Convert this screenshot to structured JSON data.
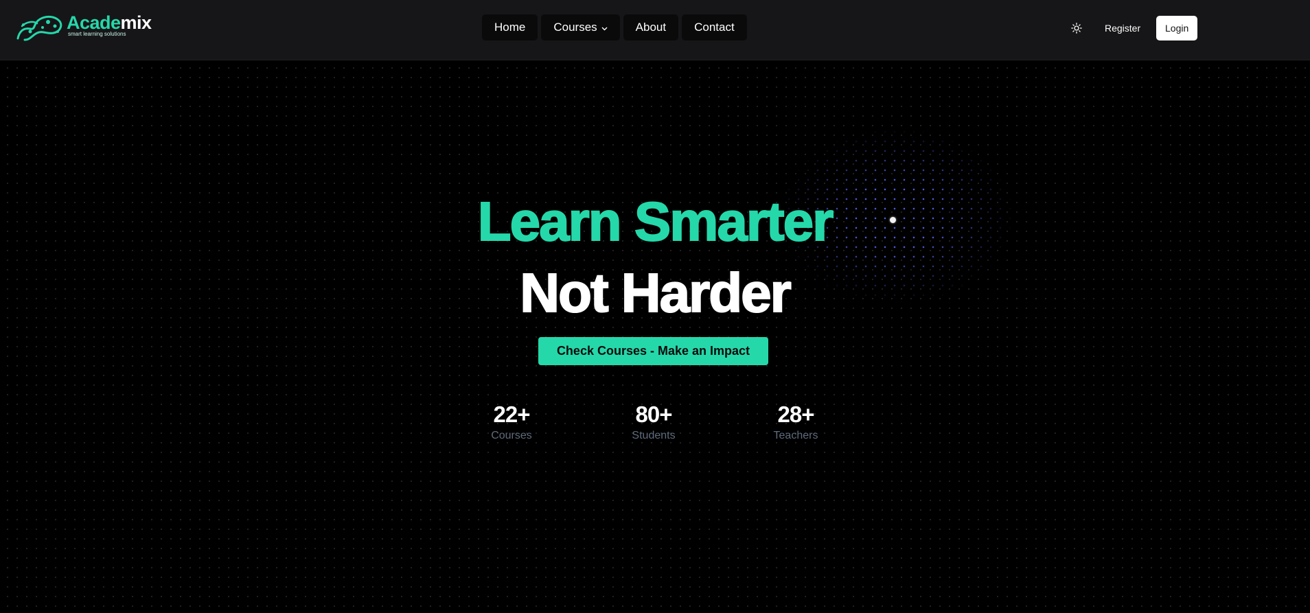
{
  "brand": {
    "name_part1": "Acade",
    "name_part2": "mix",
    "tagline": "smart learning solutions",
    "accent_color": "#25d8aa"
  },
  "nav": {
    "items": [
      {
        "label": "Home"
      },
      {
        "label": "Courses",
        "icon": "chevron-down-icon"
      },
      {
        "label": "About"
      },
      {
        "label": "Contact"
      }
    ]
  },
  "header_actions": {
    "theme_icon": "sun-icon",
    "register_label": "Register",
    "login_label": "Login"
  },
  "hero": {
    "line1": "Learn Smarter",
    "line2": "Not Harder",
    "cta_label": "Check Courses - Make an Impact"
  },
  "stats": [
    {
      "value": "22+",
      "label": "Courses"
    },
    {
      "value": "80+",
      "label": "Students"
    },
    {
      "value": "28+",
      "label": "Teachers"
    }
  ],
  "colors": {
    "background": "#000000",
    "header_bg": "#161618",
    "glow_dots": "#5c6aff",
    "stat_label": "#5f6b7d"
  }
}
